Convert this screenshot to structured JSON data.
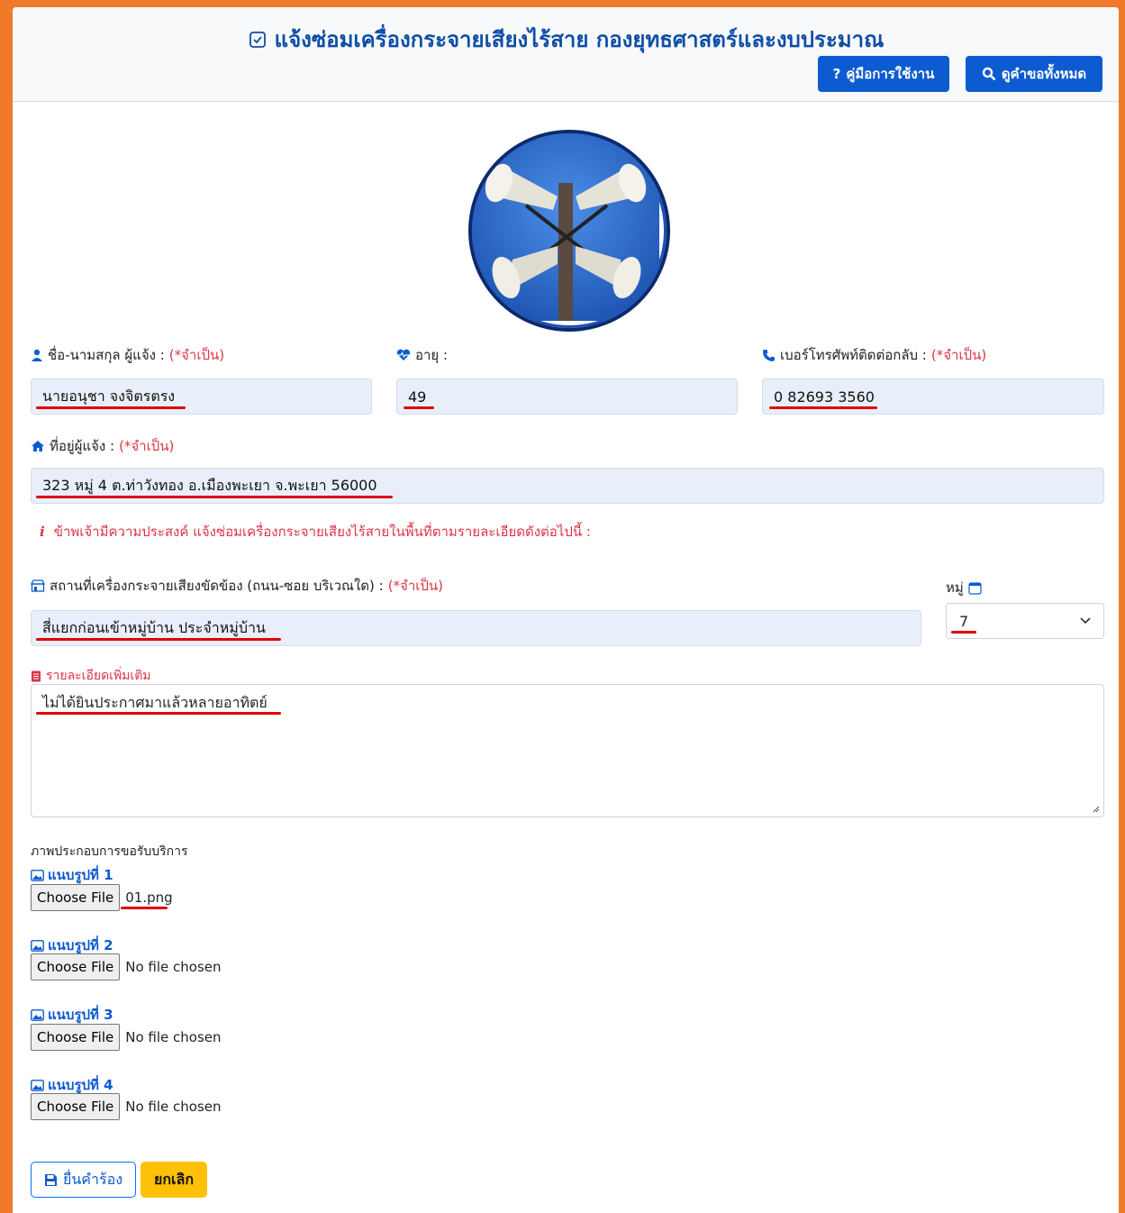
{
  "header": {
    "title": "แจ้งซ่อมเครื่องกระจายเสียงไร้สาย กองยุทธศาสตร์และงบประมาณ",
    "manual_label": "คู่มือการใช้งาน",
    "view_all_label": "ดูคำขอทั้งหมด"
  },
  "form": {
    "name_label": "ชื่อ-นามสกุล ผู้แจ้ง :",
    "name_req": "(*จำเป็น)",
    "name_value": "นายอนุชา  จงจิตรตรง",
    "age_label": "อายุ :",
    "age_value": "49",
    "phone_label": "เบอร์โทรศัพท์ติดต่อกลับ :",
    "phone_req": "(*จำเป็น)",
    "phone_value": "0 82693 3560",
    "address_label": "ที่อยู่ผู้แจ้ง :",
    "address_req": "(*จำเป็น)",
    "address_value": "323 หมู่ 4 ต.ท่าวังทอง อ.เมืองพะเยา จ.พะเยา 56000",
    "note_icon": "i",
    "note_text": "ข้าพเจ้ามีความประสงค์ แจ้งซ่อมเครื่องกระจายเสียงไร้สายในพื้นที่ตามรายละเอียดดังต่อไปนี้ :",
    "location_label": "สถานที่เครื่องกระจายเสียงขัดข้อง (ถนน-ซอย บริเวณใด) :",
    "location_req": "(*จำเป็น)",
    "location_value": "สี่แยกก่อนเข้าหมู่บ้าน ประจำหมู่บ้าน",
    "moo_label": "หมู่",
    "moo_value": "7",
    "details_label": "รายละเอียดเพิ่มเติม",
    "details_value": "ไม่ได้ยินประกาศมาแล้วหลายอาทิตย์"
  },
  "uploads": {
    "section_label": "ภาพประกอบการขอรับบริการ",
    "button_label": "Choose File",
    "items": [
      {
        "label": "แนบรูปที่ 1",
        "file": "01.png"
      },
      {
        "label": "แนบรูปที่ 2",
        "file": "No file chosen"
      },
      {
        "label": "แนบรูปที่ 3",
        "file": "No file chosen"
      },
      {
        "label": "แนบรูปที่ 4",
        "file": "No file chosen"
      }
    ]
  },
  "actions": {
    "submit_label": "ยื่นคำร้อง",
    "cancel_label": "ยกเลิก"
  },
  "colors": {
    "accent": "#0d5bd0",
    "required": "#dc3545",
    "background": "#f07a2a"
  }
}
